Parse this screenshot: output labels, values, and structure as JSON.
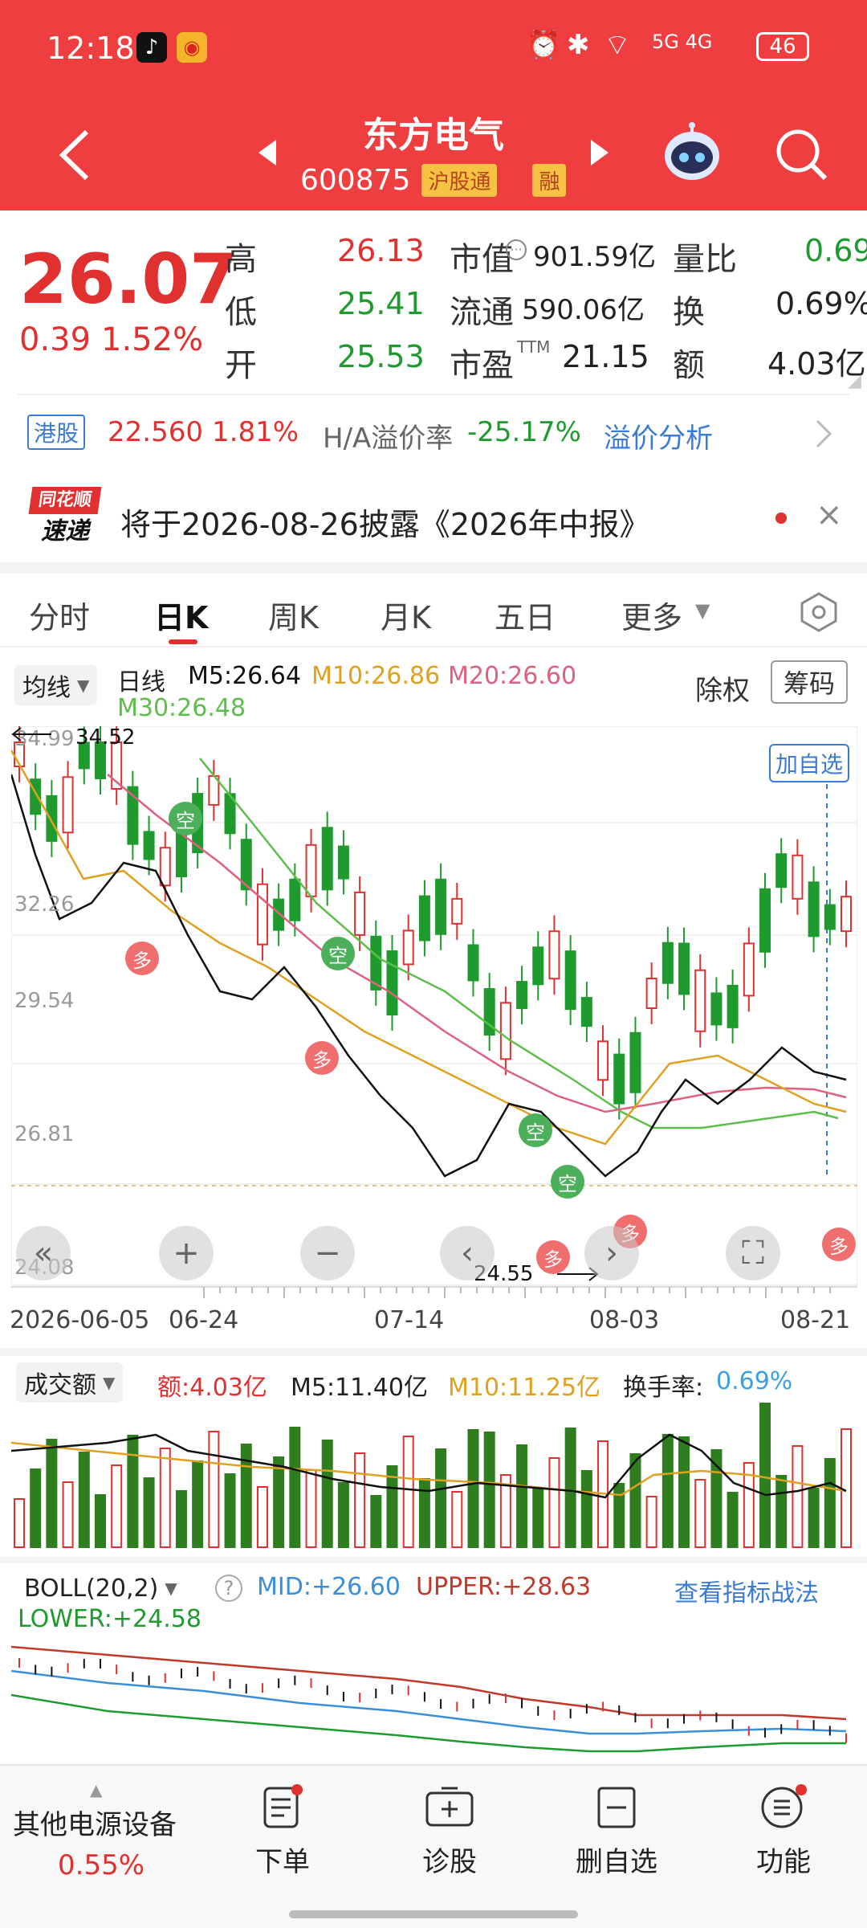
{
  "status": {
    "time": "12:18",
    "battery": "46",
    "network": "5G 4G"
  },
  "header": {
    "stock_name": "东方电气",
    "stock_code": "600875",
    "tag_hgt": "沪股通",
    "tag_rong": "融"
  },
  "quote": {
    "price": "26.07",
    "change": "0.39",
    "change_pct": "1.52%",
    "high_label": "高",
    "high": "26.13",
    "low_label": "低",
    "low": "25.41",
    "open_label": "开",
    "open": "25.53",
    "mktcap_label": "市值",
    "mktcap": "901.59亿",
    "float_label": "流通",
    "float": "590.06亿",
    "pe_label": "市盈",
    "pe_sup": "TTM",
    "pe": "21.15",
    "vr_label": "量比",
    "vr": "0.69",
    "turn_label": "换",
    "turn": "0.69%",
    "amt_label": "额",
    "amt": "4.03亿"
  },
  "hk": {
    "tag": "港股",
    "price": "22.560",
    "pct": "1.81%",
    "premium_label": "H/A溢价率",
    "premium": "-25.17%",
    "link": "溢价分析"
  },
  "notice": {
    "brand_top": "同花顺",
    "brand_bottom": "速递",
    "text": "将于2026-08-26披露《2026年中报》"
  },
  "tabs": [
    "分时",
    "日K",
    "周K",
    "月K",
    "五日",
    "更多"
  ],
  "kline": {
    "ma_select": "均线",
    "period": "日线",
    "m5": "M5:26.64",
    "m10": "M10:26.86",
    "m20": "M20:26.60",
    "m30": "M30:26.48",
    "fq": "除权",
    "chip": "筹码",
    "add_fav": "加自选",
    "y_labels": [
      "34.99",
      "32.26",
      "29.54",
      "26.81",
      "24.08"
    ],
    "max_mark": "34.52",
    "min_mark": "24.55",
    "dates": [
      "2026-06-05",
      "06-24",
      "07-14",
      "08-03",
      "08-21"
    ],
    "marker_kong": "空",
    "marker_duo": "多"
  },
  "volume": {
    "select": "成交额",
    "amt": "额:4.03亿",
    "m5": "M5:11.40亿",
    "m10": "M10:11.25亿",
    "turn_label": "换手率:",
    "turn": "0.69%"
  },
  "boll": {
    "select": "BOLL(20,2)",
    "help": "?",
    "mid": "MID:+26.60",
    "upper": "UPPER:+28.63",
    "lower": "LOWER:+24.58",
    "link": "查看指标战法"
  },
  "bottom": {
    "sector_name": "其他电源设备",
    "sector_pct": "0.55%",
    "items": [
      "下单",
      "诊股",
      "删自选",
      "功能"
    ]
  },
  "colors": {
    "brand_red": "#ee3e3f",
    "up": "#e0302f",
    "down": "#1e9a2e",
    "m5": "#111111",
    "m10": "#e0a020",
    "m20": "#e06080",
    "m30": "#5cbf4a",
    "boll_mid": "#3b8fd8",
    "boll_upper": "#c0392b",
    "boll_lower": "#1e9a2e"
  }
}
